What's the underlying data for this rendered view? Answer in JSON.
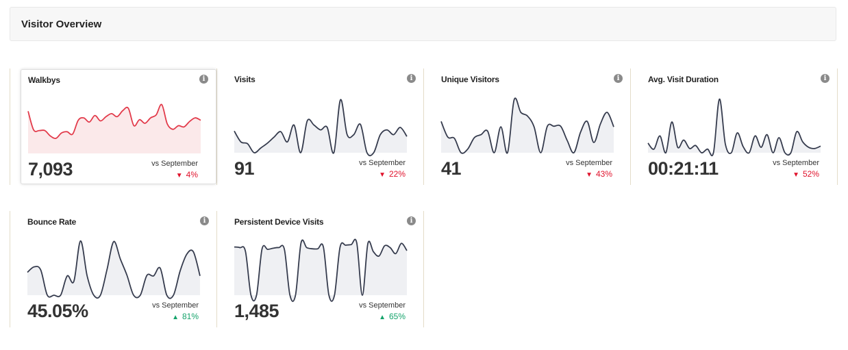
{
  "header": {
    "title": "Visitor Overview"
  },
  "colors": {
    "down": "#e0112b",
    "up": "#15a36b",
    "selected_line": "#e23a4a",
    "selected_fill": "#fbe9ea",
    "line": "#353b4d",
    "fill": "#eff0f3"
  },
  "compare_label": "vs September",
  "cards": [
    {
      "title": "Walkbys",
      "value": "7,093",
      "change": "4%",
      "direction": "down",
      "selected": true,
      "series": [
        70,
        39,
        38,
        38,
        29,
        25,
        34,
        36,
        32,
        55,
        59,
        52,
        63,
        54,
        61,
        66,
        61,
        71,
        75,
        46,
        56,
        50,
        59,
        64,
        81,
        49,
        40,
        46,
        44,
        53,
        59,
        55
      ]
    },
    {
      "title": "Visits",
      "value": "91",
      "change": "22%",
      "direction": "down",
      "selected": false,
      "series": [
        36,
        18,
        15,
        0,
        8,
        16,
        26,
        35,
        18,
        46,
        0,
        53,
        46,
        38,
        42,
        0,
        88,
        30,
        30,
        47,
        0,
        0,
        30,
        38,
        30,
        42,
        27
      ]
    },
    {
      "title": "Unique Visitors",
      "value": "41",
      "change": "43%",
      "direction": "down",
      "selected": false,
      "series": [
        52,
        26,
        24,
        0,
        6,
        25,
        30,
        36,
        0,
        43,
        0,
        88,
        67,
        61,
        43,
        0,
        44,
        44,
        44,
        20,
        0,
        34,
        52,
        17,
        48,
        67,
        43
      ]
    },
    {
      "title": "Avg. Visit Duration",
      "value": "00:21:11",
      "change": "52%",
      "direction": "down",
      "selected": false,
      "series": [
        16,
        6,
        28,
        0,
        51,
        9,
        21,
        7,
        12,
        0,
        6,
        0,
        89,
        14,
        0,
        33,
        10,
        0,
        28,
        9,
        30,
        0,
        25,
        0,
        0,
        35,
        18,
        9,
        7,
        11
      ]
    },
    {
      "title": "Bounce Rate",
      "value": "45.05%",
      "change": "81%",
      "direction": "up",
      "selected": false,
      "series": [
        38,
        47,
        42,
        0,
        0,
        0,
        32,
        23,
        90,
        32,
        0,
        0,
        43,
        89,
        60,
        33,
        0,
        0,
        33,
        32,
        45,
        0,
        0,
        40,
        68,
        72,
        32
      ]
    },
    {
      "title": "Persistent Device Visits",
      "value": "1,485",
      "change": "65%",
      "direction": "up",
      "selected": false,
      "series": [
        80,
        79,
        73,
        0,
        0,
        77,
        76,
        78,
        79,
        76,
        0,
        0,
        87,
        79,
        77,
        77,
        80,
        0,
        0,
        80,
        83,
        84,
        87,
        0,
        86,
        72,
        65,
        82,
        79,
        69,
        86,
        74
      ]
    }
  ]
}
